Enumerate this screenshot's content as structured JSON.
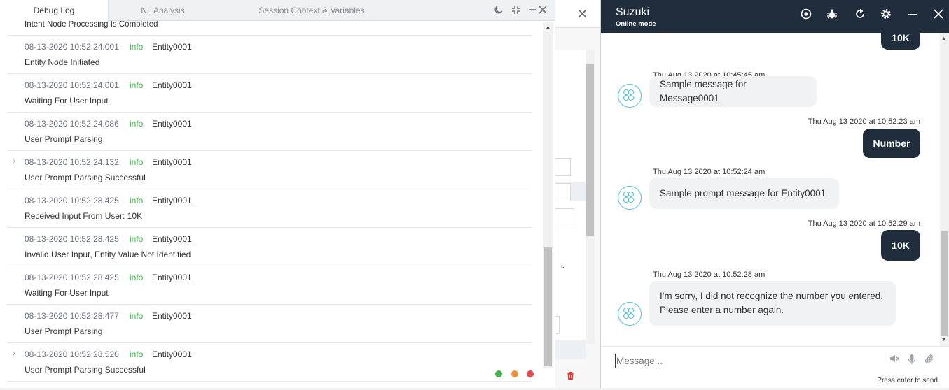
{
  "debug": {
    "tabs": [
      "Debug Log",
      "NL Analysis",
      "Session Context & Variables"
    ],
    "controls": [
      "moon-icon",
      "collapse-icon",
      "minimize-icon",
      "close-icon"
    ],
    "first_partial": "Intent Node Processing Is Completed",
    "entries": [
      {
        "time": "08-13-2020 10:52:24.001",
        "level": "info",
        "node": "Entity0001",
        "message": "Entity Node Initiated",
        "expandable": false
      },
      {
        "time": "08-13-2020 10:52:24.001",
        "level": "info",
        "node": "Entity0001",
        "message": "Waiting For User Input",
        "expandable": false
      },
      {
        "time": "08-13-2020 10:52:24.086",
        "level": "info",
        "node": "Entity0001",
        "message": "User Prompt Parsing",
        "expandable": false
      },
      {
        "time": "08-13-2020 10:52:24.132",
        "level": "info",
        "node": "Entity0001",
        "message": "User Prompt Parsing Successful",
        "expandable": true
      },
      {
        "time": "08-13-2020 10:52:28.425",
        "level": "info",
        "node": "Entity0001",
        "message": "Received Input From User: 10K",
        "expandable": false
      },
      {
        "time": "08-13-2020 10:52:28.425",
        "level": "info",
        "node": "Entity0001",
        "message": "Invalid User Input, Entity Value Not Identified",
        "expandable": false
      },
      {
        "time": "08-13-2020 10:52:28.425",
        "level": "info",
        "node": "Entity0001",
        "message": "Waiting For User Input",
        "expandable": false
      },
      {
        "time": "08-13-2020 10:52:28.477",
        "level": "info",
        "node": "Entity0001",
        "message": "User Prompt Parsing",
        "expandable": false
      },
      {
        "time": "08-13-2020 10:52:28.520",
        "level": "info",
        "node": "Entity0001",
        "message": "User Prompt Parsing Successful",
        "expandable": true
      }
    ],
    "status_dots": [
      "#3fb24a",
      "#f0913a",
      "#e5484d"
    ]
  },
  "chat": {
    "bot_name": "Suzuki",
    "mode": "Online mode",
    "header_icons": [
      "record-icon",
      "bug-icon",
      "refresh-icon",
      "settings-icon",
      "minimize-icon",
      "close-icon"
    ],
    "messages": [
      {
        "from": "user",
        "text": "10K"
      },
      {
        "from": "bot",
        "timestamp": "Thu Aug 13 2020 at 10:45:45 am",
        "text": "Sample message for Message0001"
      },
      {
        "from": "user",
        "timestamp": "Thu Aug 13 2020 at 10:52:23 am",
        "text": "Number"
      },
      {
        "from": "bot",
        "timestamp": "Thu Aug 13 2020 at 10:52:24 am",
        "text": "Sample prompt message for Entity0001"
      },
      {
        "from": "user",
        "timestamp": "Thu Aug 13 2020 at 10:52:29 am",
        "text": "10K"
      },
      {
        "from": "bot",
        "timestamp": "Thu Aug 13 2020 at 10:52:28 am",
        "text": "I'm sorry, I did not recognize the number you entered. Please enter a number again."
      }
    ],
    "composer": {
      "placeholder": "Message...",
      "hint": "Press enter to send"
    },
    "header_color": "#1f2d3d",
    "avatar_color": "#4fc3d1"
  }
}
